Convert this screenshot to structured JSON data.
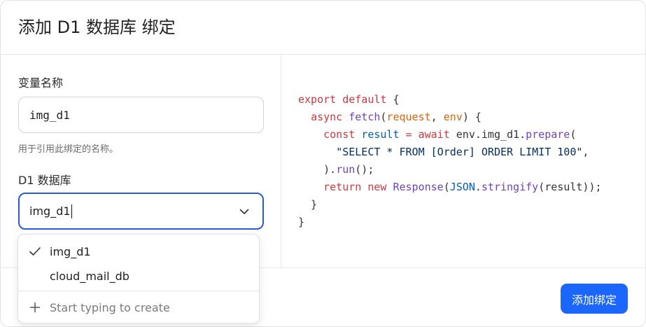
{
  "dialog": {
    "title": "添加 D1 数据库 绑定"
  },
  "form": {
    "variable_label": "变量名称",
    "variable_value": "img_d1",
    "variable_hint": "用于引用此绑定的名称。",
    "database_label": "D1 数据库",
    "database_value": "img_d1"
  },
  "dropdown": {
    "options": [
      {
        "label": "img_d1",
        "selected": true
      },
      {
        "label": "cloud_mail_db",
        "selected": false
      }
    ],
    "create_label": "Start typing to create"
  },
  "code": {
    "line1_kw": "export default",
    "line1_rest": " {",
    "line2_kw": "async",
    "line2_fn": "fetch",
    "line2_p1": "request",
    "line2_p2": "env",
    "line3_kw": "const",
    "line3_var": "result",
    "line3_eq": " = ",
    "line3_await": "await",
    "line3_obj": " env.img_d1.",
    "line3_method": "prepare",
    "line4_str": "\"SELECT * FROM [Order] ORDER LIMIT 100\"",
    "line5_fn": "run",
    "line6_kw1": "return",
    "line6_kw2": "new",
    "line6_cls": "Response",
    "line6_json": "JSON",
    "line6_fn": "stringify",
    "line6_arg": "result"
  },
  "footer": {
    "add_button": "添加绑定"
  },
  "colors": {
    "primary": "#1a66ff",
    "focus_border": "#2a5bd7"
  },
  "icons": {
    "select_toggle": "chevron-down-icon",
    "selected_mark": "check-icon",
    "create": "plus-icon"
  }
}
